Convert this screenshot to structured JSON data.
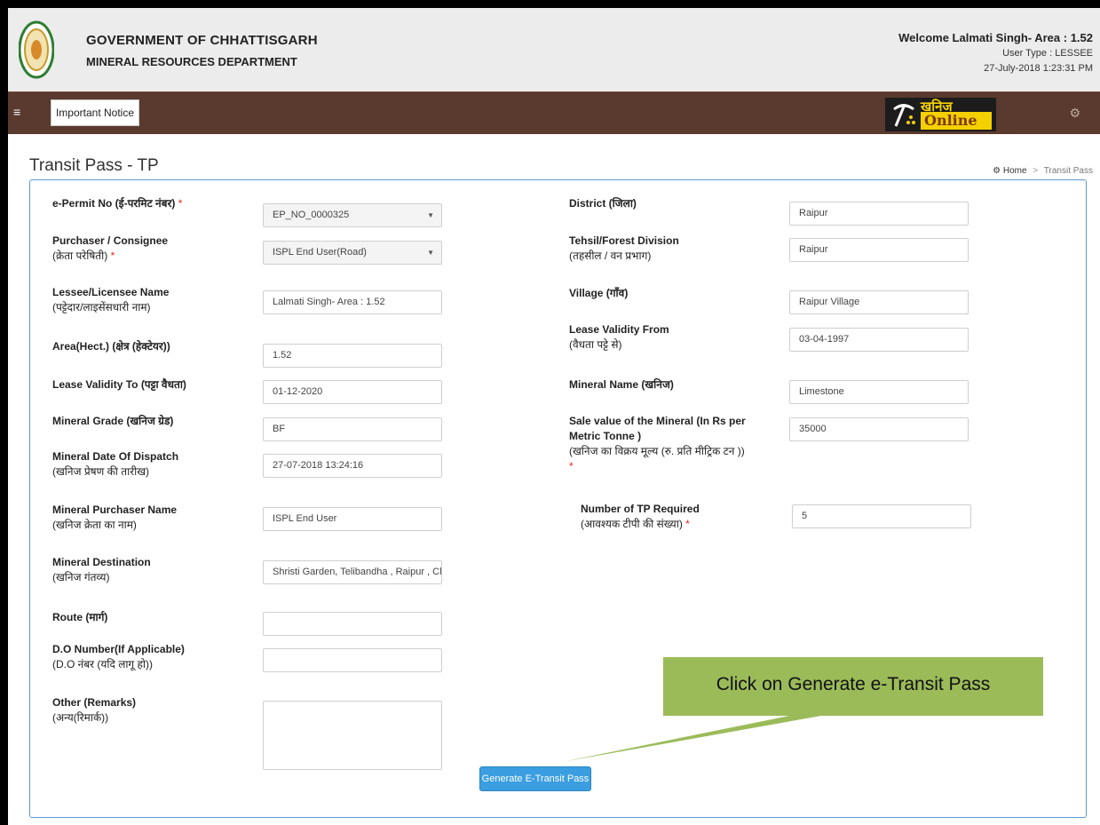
{
  "header": {
    "gov_title": "GOVERNMENT OF CHHATTISGARH",
    "dept": "MINERAL RESOURCES DEPARTMENT",
    "welcome": "Welcome Lalmati Singh- Area : 1.52",
    "user_type": "User Type : LESSEE",
    "datetime": "27-July-2018 1:23:31 PM"
  },
  "nav": {
    "notice_label": "Important Notice",
    "logo_hindi": "खनिज",
    "logo_online": "Online"
  },
  "page": {
    "title": "Transit Pass - TP",
    "breadcrumb_home": "Home",
    "breadcrumb_current": "Transit Pass"
  },
  "form": {
    "epermit": {
      "label": "e-Permit No (ई-परमिट नंबर)",
      "value": "EP_NO_0000325"
    },
    "purchaser": {
      "label": "Purchaser / Consignee",
      "sub": "(क्रेता परेषिती)",
      "value": "ISPL End User(Road)"
    },
    "lessee": {
      "label": "Lessee/Licensee Name",
      "sub": "(पट्टेदार/लाइसेंसधारी नाम)",
      "value": "Lalmati Singh- Area : 1.52"
    },
    "area": {
      "label": "Area(Hect.) (क्षेत्र (हेक्टेयर))",
      "value": "1.52"
    },
    "lease_to": {
      "label": "Lease Validity To (पट्टा वैधता)",
      "value": "01-12-2020"
    },
    "grade": {
      "label": "Mineral Grade (खनिज ग्रेड)",
      "value": "BF"
    },
    "dispatch": {
      "label": "Mineral Date Of Dispatch",
      "sub": "(खनिज प्रेषण की तारीख)",
      "value": "27-07-2018 13:24:16"
    },
    "purchaser_name": {
      "label": "Mineral Purchaser Name",
      "sub": "(खनिज क्रेता का नाम)",
      "value": "ISPL End User"
    },
    "destination": {
      "label": "Mineral Destination",
      "sub": "(खनिज गंतव्य)",
      "value": "Shristi Garden, Telibandha , Raipur , Chh"
    },
    "route": {
      "label": "Route (मार्ग)",
      "value": ""
    },
    "do_number": {
      "label": "D.O Number(If Applicable)",
      "sub": "(D.O नंबर (यदि लागू हो))",
      "value": ""
    },
    "remarks": {
      "label": "Other (Remarks)",
      "sub": "(अन्य(रिमार्क))",
      "value": ""
    },
    "district": {
      "label": "District (जिला)",
      "value": "Raipur"
    },
    "tehsil": {
      "label": "Tehsil/Forest Division",
      "sub": "(तहसील / वन प्रभाग)",
      "value": "Raipur"
    },
    "village": {
      "label": "Village (गाँव)",
      "value": "Raipur Village"
    },
    "lease_from": {
      "label": "Lease Validity From",
      "sub": "(वैधता पट्टे से)",
      "value": "03-04-1997"
    },
    "mineral_name": {
      "label": "Mineral Name (खनिज)",
      "value": "Limestone"
    },
    "sale_value": {
      "label": "Sale value of the Mineral (In Rs per",
      "label2": "Metric Tonne )",
      "sub": "(खनिज का विक्रय मूल्य (रु. प्रति मीट्रिक टन ))",
      "value": "35000"
    },
    "tp_required": {
      "label": "Number of TP Required",
      "sub": "(आवश्यक टीपी की संख्या)",
      "value": "5"
    },
    "required_mark": "*",
    "generate_label": "Generate E-Transit Pass"
  },
  "callout": {
    "text": "Click on Generate e-Transit Pass"
  },
  "colors": {
    "navbar": "#5a3a2e",
    "button": "#3a9ee0",
    "callout": "#9bbb59",
    "panel_border": "#5b9bd5"
  }
}
